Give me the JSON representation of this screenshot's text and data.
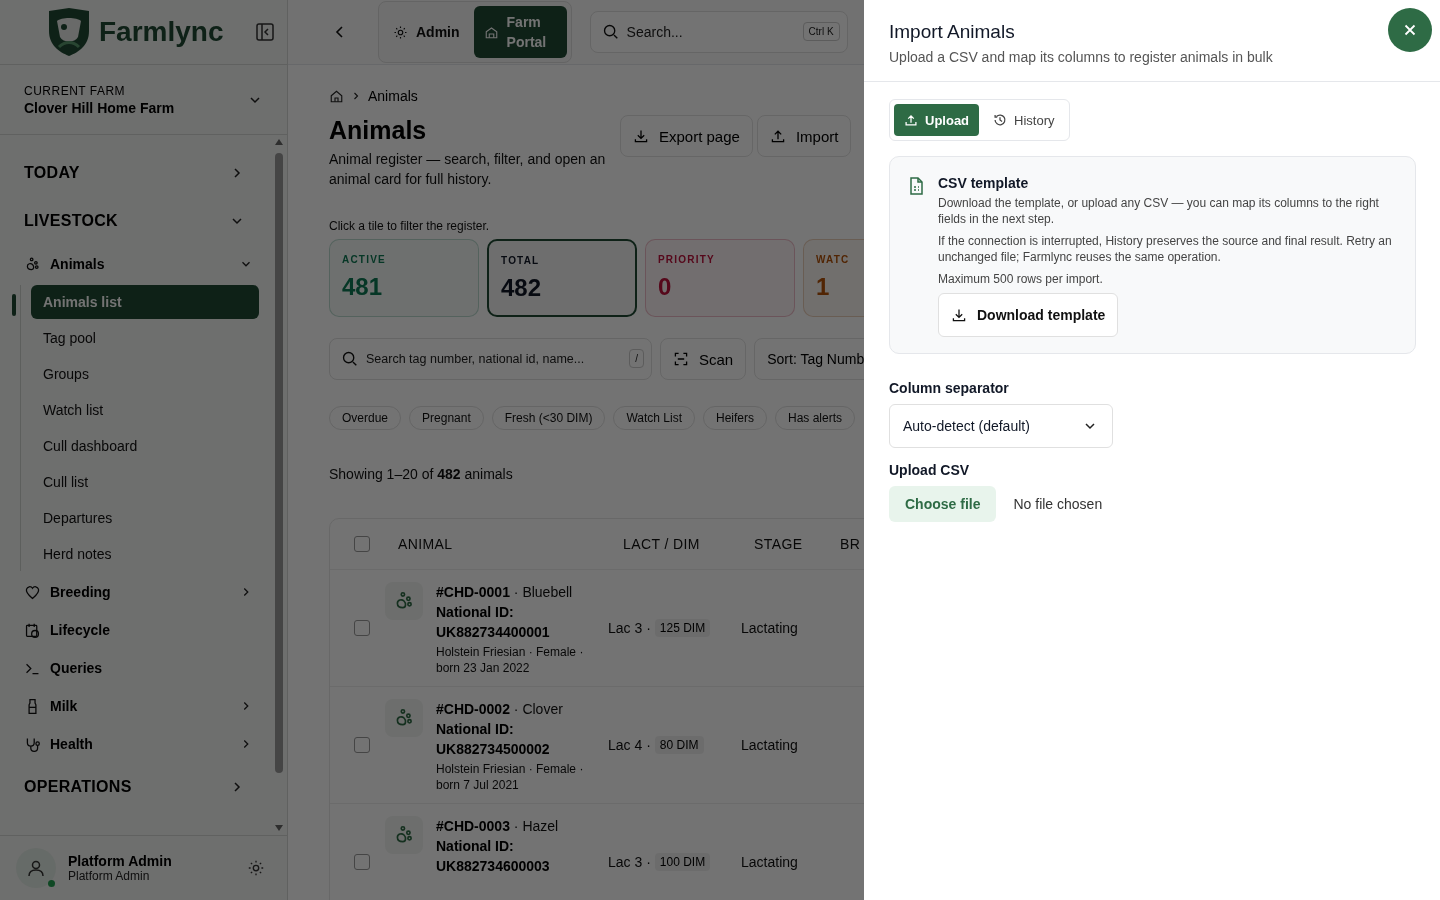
{
  "sidebar": {
    "brand": "Farmlync",
    "current_farm": {
      "label": "CURRENT FARM",
      "name": "Clover Hill Home Farm"
    },
    "sections": [
      {
        "label": "TODAY",
        "expanded": false
      },
      {
        "label": "LIVESTOCK",
        "expanded": true,
        "items": [
          {
            "label": "Animals",
            "kind": "group",
            "expanded": true,
            "children": [
              {
                "label": "Animals list",
                "selected": true
              },
              {
                "label": "Tag pool",
                "selected": false
              },
              {
                "label": "Groups",
                "selected": false
              },
              {
                "label": "Watch list",
                "selected": false
              },
              {
                "label": "Cull dashboard",
                "selected": false
              },
              {
                "label": "Cull list",
                "selected": false
              },
              {
                "label": "Departures",
                "selected": false
              },
              {
                "label": "Herd notes",
                "selected": false
              }
            ]
          },
          {
            "label": "Breeding",
            "kind": "group",
            "expanded": false
          },
          {
            "label": "Lifecycle",
            "kind": "link"
          },
          {
            "label": "Queries",
            "kind": "link"
          },
          {
            "label": "Milk",
            "kind": "group",
            "expanded": false
          },
          {
            "label": "Health",
            "kind": "group",
            "expanded": false
          }
        ]
      },
      {
        "label": "OPERATIONS",
        "expanded": false
      }
    ],
    "user": {
      "name": "Platform Admin",
      "role": "Platform Admin",
      "online": true
    }
  },
  "topbar": {
    "tabs": [
      {
        "label": "Admin",
        "selected": false
      },
      {
        "label": "Farm Portal",
        "selected": true
      }
    ],
    "search": {
      "placeholder": "Search...",
      "shortcut": "Ctrl K"
    }
  },
  "page": {
    "breadcrumb": [
      "Animals"
    ],
    "title": "Animals",
    "description": "Animal register — search, filter, and open an animal card for full history.",
    "actions": [
      "Export page",
      "Import"
    ],
    "tiles_hint": "Click a tile to filter the register.",
    "tiles": [
      {
        "label": "ACTIVE",
        "value": "481",
        "kind": "active",
        "selected": false
      },
      {
        "label": "TOTAL",
        "value": "482",
        "kind": "total",
        "selected": true
      },
      {
        "label": "PRIORITY",
        "value": "0",
        "kind": "priority",
        "selected": false
      },
      {
        "label": "WATC",
        "value": "1",
        "kind": "watch",
        "selected": false
      }
    ],
    "search": {
      "placeholder": "Search tag number, national id, name...",
      "shortcut": "/"
    },
    "scan": "Scan",
    "sort": "Sort: Tag Numb",
    "chips": [
      "Overdue",
      "Pregnant",
      "Fresh (<30 DIM)",
      "Watch List",
      "Heifers",
      "Has alerts"
    ],
    "summary": "Showing 1–20 of **482** animals",
    "table": {
      "columns": [
        "ANIMAL",
        "LACT / DIM",
        "STAGE",
        "BR"
      ],
      "all_checked": false,
      "rows": [
        {
          "tag": "#CHD-0001",
          "name": "· Bluebell",
          "national_id_label": "National ID:",
          "national_id": "UK882734400001",
          "details": "Holstein Friesian · Female · born 23 Jan 2022",
          "lactation": "Lac 3 ·",
          "dim": "125 DIM",
          "stage": "Lactating",
          "checked": false
        },
        {
          "tag": "#CHD-0002",
          "name": "· Clover",
          "national_id_label": "National ID:",
          "national_id": "UK882734500002",
          "details": "Holstein Friesian · Female · born 7 Jul 2021",
          "lactation": "Lac 4 ·",
          "dim": "80 DIM",
          "stage": "Lactating",
          "checked": false
        },
        {
          "tag": "#CHD-0003",
          "name": "· Hazel",
          "national_id_label": "National ID:",
          "national_id": "UK882734600003",
          "lactation": "Lac 3 ·",
          "dim": "100 DIM",
          "stage": "Lactating",
          "checked": false
        }
      ]
    }
  },
  "drawer": {
    "title": "Import Animals",
    "subtitle": "Upload a CSV and map its columns to register animals in bulk",
    "tabs": [
      {
        "label": "Upload",
        "selected": true
      },
      {
        "label": "History",
        "selected": false
      }
    ],
    "template_card": {
      "title": "CSV template",
      "paragraphs": [
        "Download the template, or upload any CSV — you can map its columns to the right fields in the next step.",
        "If the connection is interrupted, History preserves the source and final result. Retry an unchanged file; Farmlync reuses the same operation.",
        "Maximum 500 rows per import."
      ],
      "button": "Download template"
    },
    "separator": {
      "label": "Column separator",
      "value": "Auto-detect (default)"
    },
    "upload": {
      "label": "Upload CSV",
      "button": "Choose file",
      "status": "No file chosen"
    }
  }
}
